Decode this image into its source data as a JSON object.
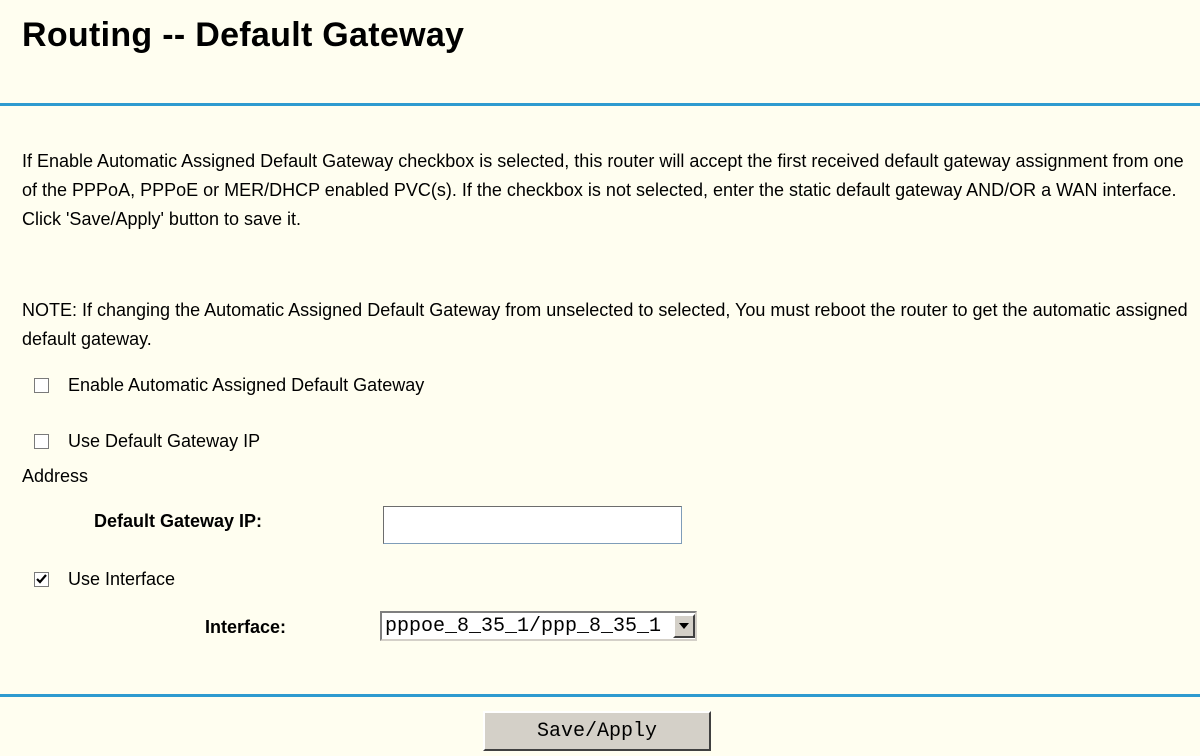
{
  "page": {
    "title": "Routing -- Default Gateway",
    "description": "If Enable Automatic Assigned Default Gateway checkbox is selected, this router will accept the first received default gateway assignment from one of the PPPoA, PPPoE or MER/DHCP enabled PVC(s). If the checkbox is not selected, enter the static default gateway AND/OR a WAN interface. Click 'Save/Apply' button to save it.",
    "note": "NOTE: If changing the Automatic Assigned Default Gateway from unselected to selected, You must reboot the router to get the automatic assigned default gateway."
  },
  "form": {
    "enable_auto": {
      "label": "Enable Automatic Assigned Default Gateway",
      "checked": false
    },
    "use_gateway_ip": {
      "label": "Use Default Gateway IP",
      "label_cont": "Address",
      "checked": false
    },
    "gateway_ip": {
      "label": "Default Gateway IP:",
      "value": ""
    },
    "use_interface": {
      "label": "Use Interface",
      "checked": true
    },
    "interface": {
      "label": "Interface:",
      "selected": "pppoe_8_35_1/ppp_8_35_1"
    },
    "save_label": "Save/Apply"
  }
}
